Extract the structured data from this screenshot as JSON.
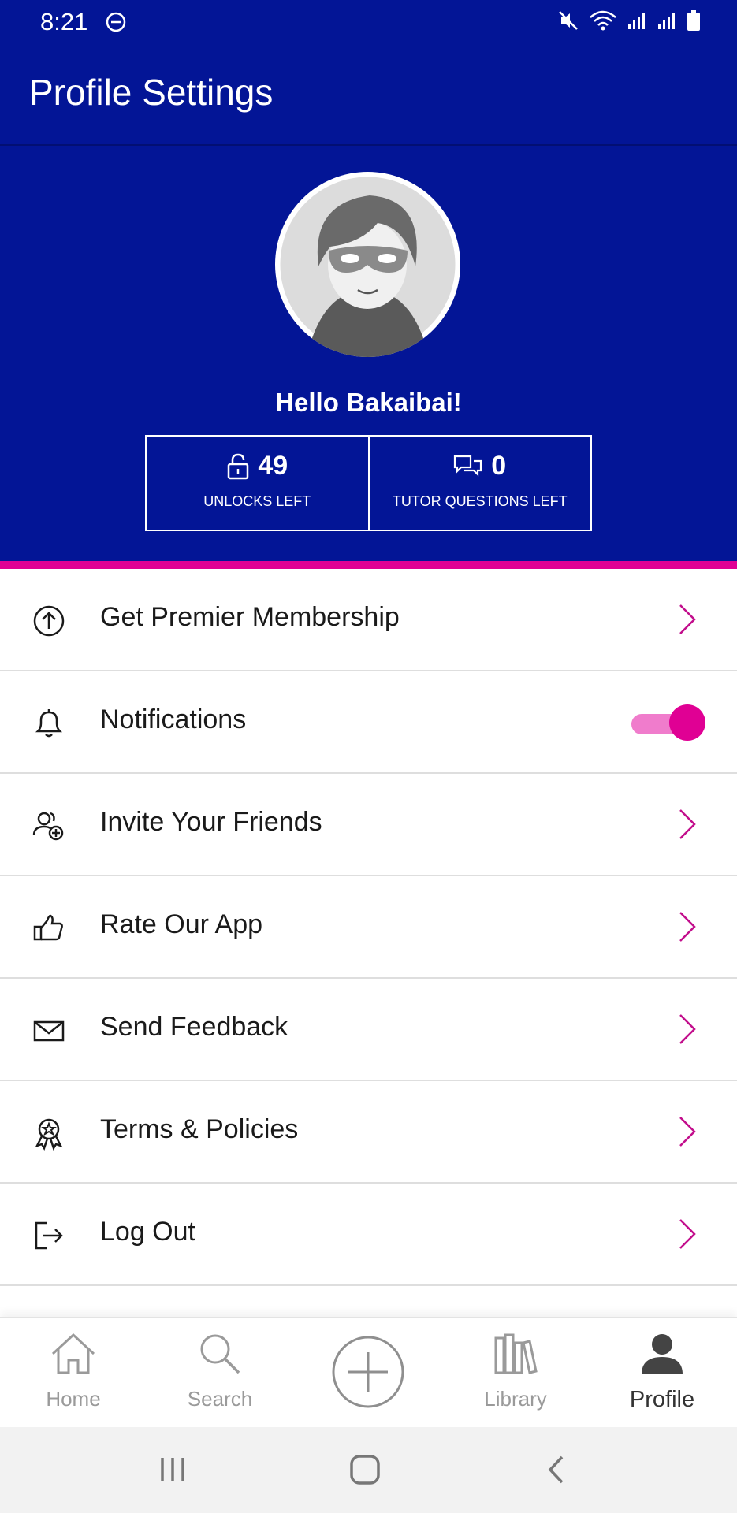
{
  "status_bar": {
    "time": "8:21",
    "icons": [
      "dnd-icon",
      "mute-icon",
      "wifi-icon",
      "signal-icon",
      "signal-icon",
      "battery-icon"
    ]
  },
  "app_bar": {
    "title": "Profile Settings"
  },
  "profile": {
    "greeting": "Hello Bakaibai!",
    "stats": [
      {
        "value": "49",
        "label": "UNLOCKS LEFT",
        "icon": "lock-icon"
      },
      {
        "value": "0",
        "label": "TUTOR QUESTIONS LEFT",
        "icon": "chat-bubbles-icon"
      }
    ]
  },
  "menu": {
    "items": [
      {
        "label": "Get Premier Membership",
        "icon": "arrow-up-circle-icon",
        "control": "chevron"
      },
      {
        "label": "Notifications",
        "icon": "bell-icon",
        "control": "toggle",
        "toggle_on": true
      },
      {
        "label": "Invite Your Friends",
        "icon": "add-friend-icon",
        "control": "chevron"
      },
      {
        "label": "Rate Our App",
        "icon": "thumbs-up-icon",
        "control": "chevron"
      },
      {
        "label": "Send Feedback",
        "icon": "envelope-icon",
        "control": "chevron"
      },
      {
        "label": "Terms & Policies",
        "icon": "badge-icon",
        "control": "chevron"
      },
      {
        "label": "Log Out",
        "icon": "logout-icon",
        "control": "chevron"
      }
    ]
  },
  "bottom_nav": {
    "items": [
      {
        "label": "Home",
        "icon": "home-icon",
        "active": false
      },
      {
        "label": "Search",
        "icon": "search-icon",
        "active": false
      },
      {
        "label": "",
        "icon": "add-circle-icon",
        "active": false
      },
      {
        "label": "Library",
        "icon": "library-icon",
        "active": false
      },
      {
        "label": "Profile",
        "icon": "person-icon",
        "active": true
      }
    ]
  },
  "colors": {
    "header_bg": "#031596",
    "accent": "#e00094",
    "toggle_track": "#f07ccc",
    "divider": "#dedede"
  }
}
